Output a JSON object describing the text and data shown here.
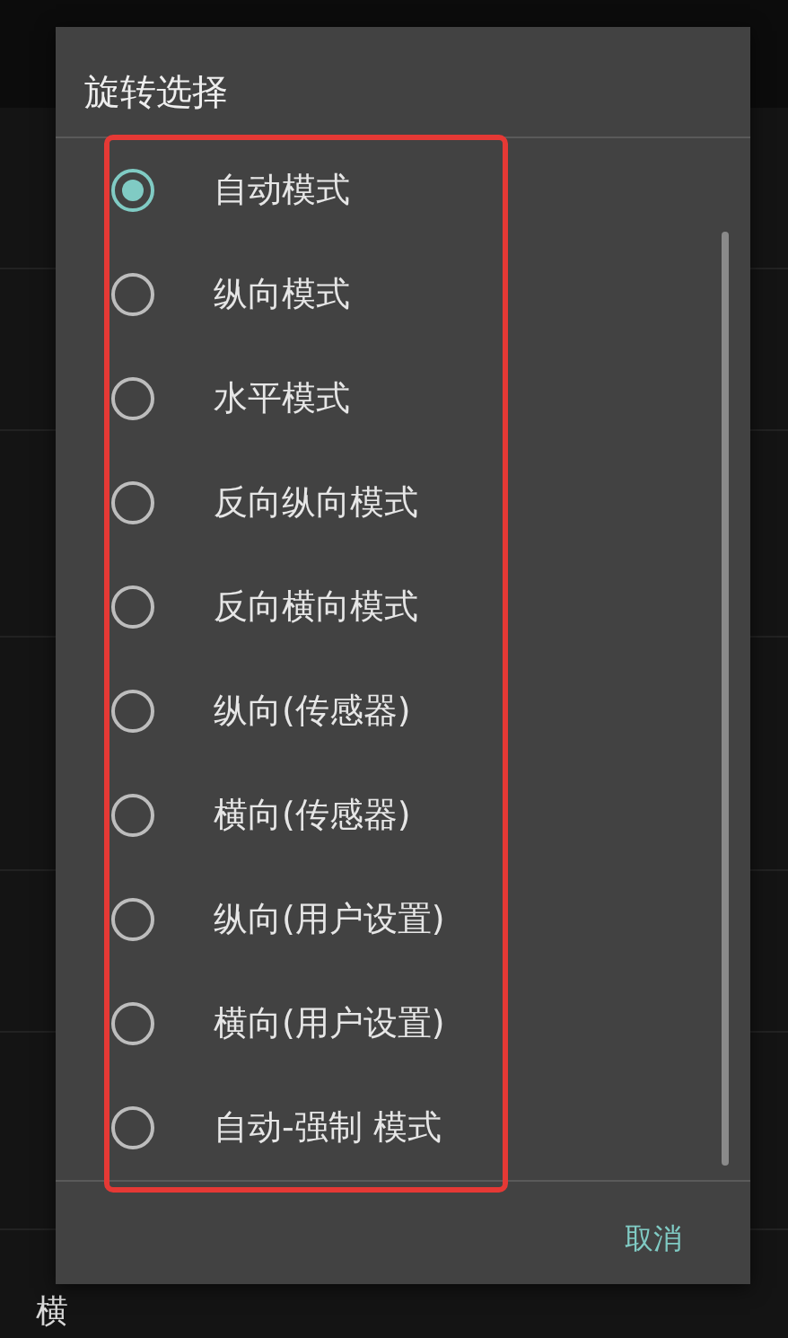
{
  "background": {
    "last_item": {
      "title": "横"
    }
  },
  "dialog": {
    "title": "旋转选择",
    "options": [
      {
        "label": "自动模式",
        "selected": true
      },
      {
        "label": "纵向模式",
        "selected": false
      },
      {
        "label": "水平模式",
        "selected": false
      },
      {
        "label": "反向纵向模式",
        "selected": false
      },
      {
        "label": "反向横向模式",
        "selected": false
      },
      {
        "label": "纵向(传感器)",
        "selected": false
      },
      {
        "label": "横向(传感器)",
        "selected": false
      },
      {
        "label": "纵向(用户设置)",
        "selected": false
      },
      {
        "label": "横向(用户设置)",
        "selected": false
      },
      {
        "label": "自动-强制 模式",
        "selected": false
      }
    ],
    "cancel": "取消"
  }
}
